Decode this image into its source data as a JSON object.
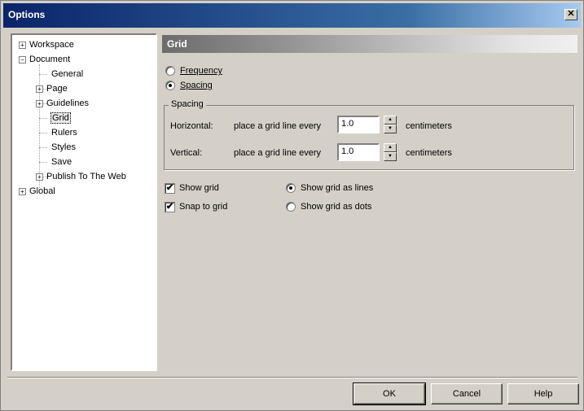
{
  "window": {
    "title": "Options",
    "close_glyph": "✕"
  },
  "tree": {
    "items": [
      {
        "label": "Workspace",
        "expander": "+"
      },
      {
        "label": "Document",
        "expander": "−"
      },
      {
        "label": "General"
      },
      {
        "label": "Page",
        "expander": "+"
      },
      {
        "label": "Guidelines",
        "expander": "+"
      },
      {
        "label": "Grid",
        "selected": true
      },
      {
        "label": "Rulers"
      },
      {
        "label": "Styles"
      },
      {
        "label": "Save"
      },
      {
        "label": "Publish To The Web",
        "expander": "+"
      },
      {
        "label": "Global",
        "expander": "+"
      }
    ]
  },
  "panel": {
    "header": "Grid",
    "mode_frequency": "Frequency",
    "mode_spacing": "Spacing",
    "selected_mode": "Spacing",
    "spacing_group": {
      "title": "Spacing",
      "horizontal_label": "Horizontal:",
      "vertical_label": "Vertical:",
      "place_text": "place a grid line every",
      "horizontal_value": "1.0",
      "vertical_value": "1.0",
      "unit": "centimeters"
    },
    "show_grid": {
      "label": "Show grid",
      "checked": true
    },
    "snap_to_grid": {
      "label": "Snap to grid",
      "checked": true
    },
    "show_as_lines": {
      "label": "Show grid as lines",
      "selected": true
    },
    "show_as_dots": {
      "label": "Show grid as dots",
      "selected": false
    }
  },
  "buttons": {
    "ok": "OK",
    "cancel": "Cancel",
    "help": "Help"
  },
  "colors": {
    "title_bar": "#0a246a",
    "face": "#d4d0c8"
  }
}
